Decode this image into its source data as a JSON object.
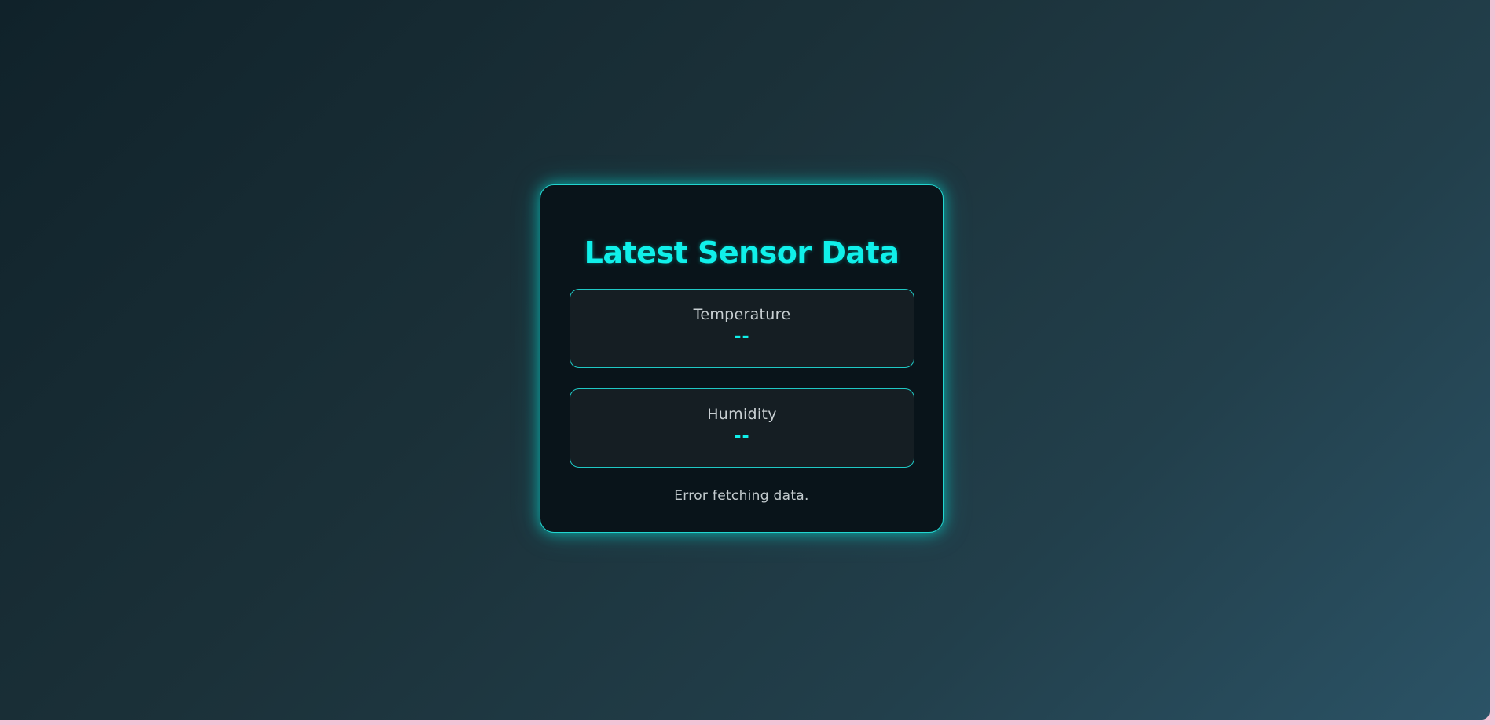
{
  "app": {
    "title": "Latest Sensor Data"
  },
  "readings": [
    {
      "label": "Temperature",
      "value": "--"
    },
    {
      "label": "Humidity",
      "value": "--"
    }
  ],
  "status": {
    "message": "Error fetching data."
  },
  "colors": {
    "accent": "#10f0ea",
    "card_background": "#09141a",
    "panel_background": "#151e23",
    "text_muted": "#c9d0d3",
    "page_gradient_start": "#10222a",
    "page_gradient_end": "#2b5366",
    "frame": "#f2c4d6"
  }
}
